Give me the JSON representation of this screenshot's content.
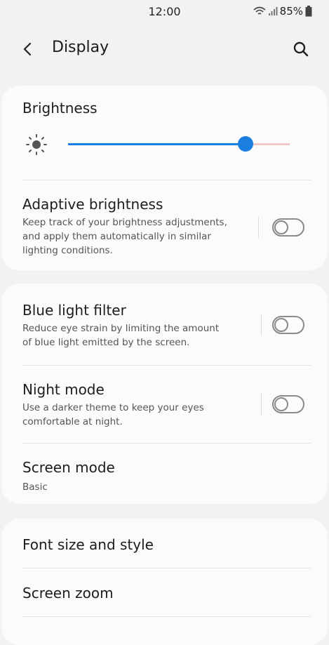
{
  "status_bar": {
    "time": "12:00",
    "battery": "85%",
    "icons": [
      "wifi-icon",
      "signal-icon",
      "battery-icon"
    ]
  },
  "app_bar": {
    "title": "Display",
    "back_icon": "back-arrow-icon",
    "search_icon": "search-icon"
  },
  "brightness": {
    "title": "Brightness",
    "icon": "sun-icon",
    "level": 0.8,
    "accent_color": "#1a7fe0"
  },
  "adaptive_brightness": {
    "title": "Adaptive brightness",
    "description_lines": [
      "Keep track of your brightness adjustments,",
      "and apply them automatically in similar",
      "lighting conditions."
    ],
    "enabled": false
  },
  "blue_light_filter": {
    "title": "Blue light filter",
    "description_lines": [
      "Reduce eye strain by limiting the amount",
      "of blue light emitted by the screen."
    ],
    "enabled": false
  },
  "night_mode": {
    "title": "Night mode",
    "description_lines": [
      "Use a darker theme to keep your eyes",
      "comfortable at night."
    ],
    "enabled": false
  },
  "screen_mode": {
    "title": "Screen mode",
    "value": "Basic"
  },
  "font_size": {
    "title": "Font size and style"
  },
  "screen_zoom": {
    "title": "Screen zoom"
  }
}
